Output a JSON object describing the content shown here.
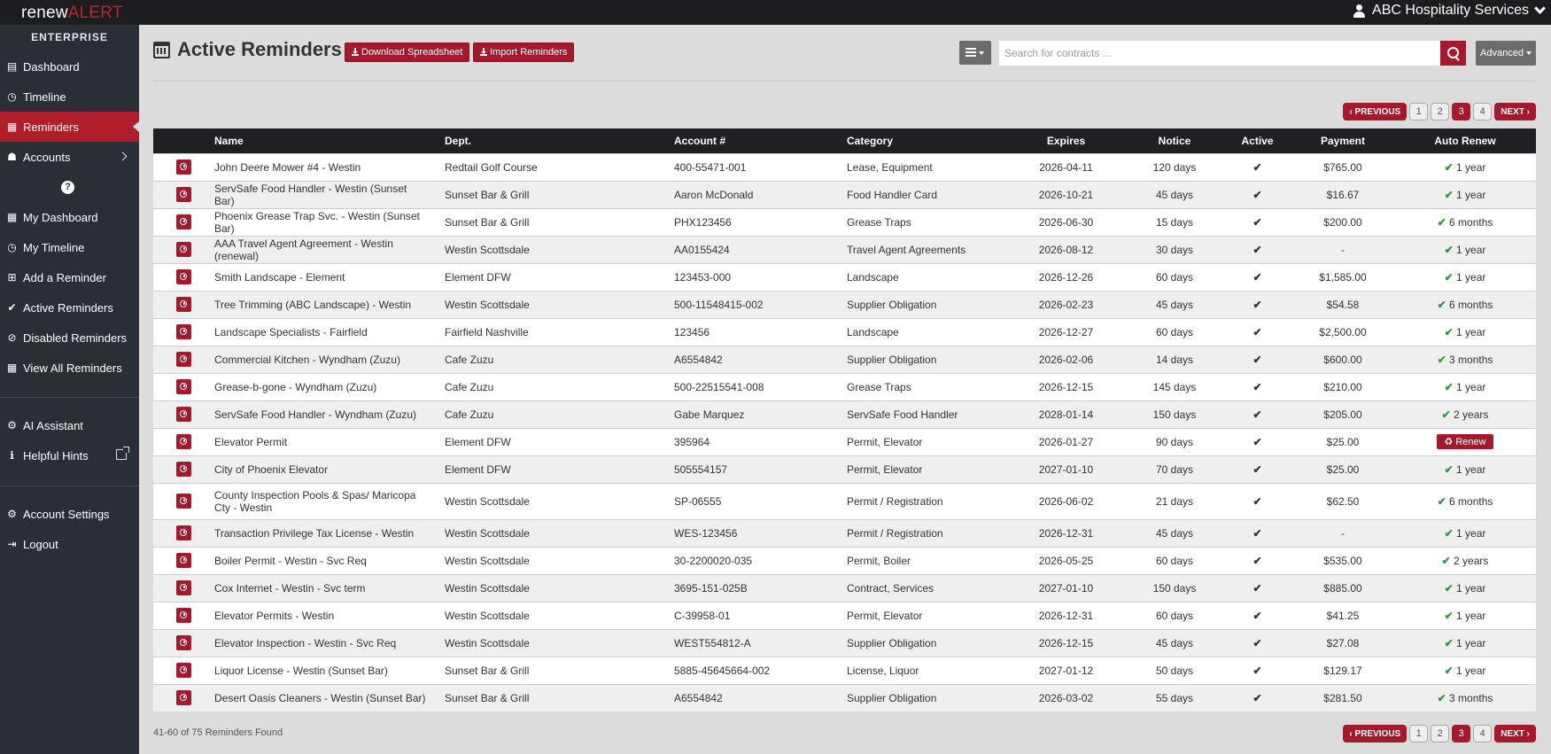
{
  "app": {
    "logo_text_1": "renew",
    "logo_text_2": "ALERT",
    "edition": "ENTERPRISE",
    "user": "ABC Hospitality Services"
  },
  "sidebar": {
    "primary": [
      {
        "label": "Dashboard",
        "icon": "dashboard-icon"
      },
      {
        "label": "Timeline",
        "icon": "clock-icon"
      },
      {
        "label": "Reminders",
        "icon": "calendar-icon",
        "active": true
      },
      {
        "label": "Accounts",
        "icon": "users-icon"
      }
    ],
    "help": "?",
    "secondary": [
      {
        "label": "My Dashboard",
        "icon": "grid-icon"
      },
      {
        "label": "My Timeline",
        "icon": "clock-icon"
      },
      {
        "label": "Add a Reminder",
        "icon": "calendar-plus-icon"
      },
      {
        "label": "Active Reminders",
        "icon": "check-icon"
      },
      {
        "label": "Disabled Reminders",
        "icon": "ban-icon"
      },
      {
        "label": "View All Reminders",
        "icon": "calendar-icon"
      }
    ],
    "tools": [
      {
        "label": "AI Assistant",
        "icon": "gears-icon"
      },
      {
        "label": "Helpful Hints",
        "icon": "info-icon"
      }
    ],
    "account": [
      {
        "label": "Account Settings",
        "icon": "gear-icon"
      },
      {
        "label": "Logout",
        "icon": "logout-icon"
      }
    ]
  },
  "header": {
    "title": "Active Reminders",
    "download_label": "Download Spreadsheet",
    "import_label": "Import Reminders",
    "search_placeholder": "Search for contracts ...",
    "advanced_label": "Advanced"
  },
  "pagination": {
    "prev": "‹ PREVIOUS",
    "next": "NEXT ›",
    "pages": [
      "1",
      "2",
      "3",
      "4"
    ],
    "current": "3"
  },
  "table": {
    "columns": [
      "Name",
      "Dept.",
      "Account #",
      "Category",
      "Expires",
      "Notice",
      "Active",
      "Payment",
      "Auto Renew"
    ],
    "rows": [
      {
        "name": "John Deere Mower #4 - Westin",
        "dept": "Redtail Golf Course",
        "account": "400-55471-001",
        "category": "Lease, Equipment",
        "expires": "2026-04-11",
        "notice": "120 days",
        "active": "✔",
        "payment": "$765.00",
        "renew": "✔ 1 year"
      },
      {
        "name": "ServSafe Food Handler - Westin (Sunset Bar)",
        "dept": "Sunset Bar & Grill",
        "account": "Aaron McDonald",
        "category": "Food Handler Card",
        "expires": "2026-10-21",
        "notice": "45 days",
        "active": "✔",
        "payment": "$16.67",
        "renew": "✔ 1 year"
      },
      {
        "name": "Phoenix Grease Trap Svc. - Westin (Sunset Bar)",
        "dept": "Sunset Bar & Grill",
        "account": "PHX123456",
        "category": "Grease Traps",
        "expires": "2026-06-30",
        "notice": "15 days",
        "active": "✔",
        "payment": "$200.00",
        "renew": "✔ 6 months"
      },
      {
        "name": "AAA Travel Agent Agreement - Westin (renewal)",
        "dept": "Westin Scottsdale",
        "account": "AA0155424",
        "category": "Travel Agent Agreements",
        "expires": "2026-08-12",
        "notice": "30 days",
        "active": "✔",
        "payment": "-",
        "renew": "✔ 1 year"
      },
      {
        "name": "Smith Landscape - Element",
        "dept": "Element DFW",
        "account": "123453-000",
        "category": "Landscape",
        "expires": "2026-12-26",
        "notice": "60 days",
        "active": "✔",
        "payment": "$1,585.00",
        "renew": "✔ 1 year"
      },
      {
        "name": "Tree Trimming (ABC Landscape) - Westin",
        "dept": "Westin Scottsdale",
        "account": "500-11548415-002",
        "category": "Supplier Obligation",
        "expires": "2026-02-23",
        "notice": "45 days",
        "active": "✔",
        "payment": "$54.58",
        "renew": "✔ 6 months"
      },
      {
        "name": "Landscape Specialists - Fairfield",
        "dept": "Fairfield Nashville",
        "account": "123456",
        "category": "Landscape",
        "expires": "2026-12-27",
        "notice": "60 days",
        "active": "✔",
        "payment": "$2,500.00",
        "renew": "✔ 1 year"
      },
      {
        "name": "Commercial Kitchen - Wyndham (Zuzu)",
        "dept": "Cafe Zuzu",
        "account": "A6554842",
        "category": "Supplier Obligation",
        "expires": "2026-02-06",
        "notice": "14 days",
        "active": "✔",
        "payment": "$600.00",
        "renew": "✔ 3 months"
      },
      {
        "name": "Grease-b-gone - Wyndham (Zuzu)",
        "dept": "Cafe Zuzu",
        "account": "500-22515541-008",
        "category": "Grease Traps",
        "expires": "2026-12-15",
        "notice": "145 days",
        "active": "✔",
        "payment": "$210.00",
        "renew": "✔ 1 year"
      },
      {
        "name": "ServSafe Food Handler - Wyndham (Zuzu)",
        "dept": "Cafe Zuzu",
        "account": "Gabe Marquez",
        "category": "ServSafe Food Handler",
        "expires": "2028-01-14",
        "notice": "150 days",
        "active": "✔",
        "payment": "$205.00",
        "renew": "✔ 2 years"
      },
      {
        "name": "Elevator Permit",
        "dept": "Element DFW",
        "account": "395964",
        "category": "Permit, Elevator",
        "expires": "2026-01-27",
        "notice": "90 days",
        "active": "✔",
        "payment": "$25.00",
        "renew": "♻ Renew",
        "renew_button": true
      },
      {
        "name": "City of Phoenix Elevator",
        "dept": "Element DFW",
        "account": "505554157",
        "category": "Permit, Elevator",
        "expires": "2027-01-10",
        "notice": "70 days",
        "active": "✔",
        "payment": "$25.00",
        "renew": "✔ 1 year"
      },
      {
        "name": "County Inspection Pools & Spas/ Maricopa Cty - Westin",
        "dept": "Westin Scottsdale",
        "account": "SP-06555",
        "category": "Permit / Registration",
        "expires": "2026-06-02",
        "notice": "21 days",
        "active": "✔",
        "payment": "$62.50",
        "renew": "✔ 6 months"
      },
      {
        "name": "Transaction Privilege Tax License - Westin",
        "dept": "Westin Scottsdale",
        "account": "WES-123456",
        "category": "Permit / Registration",
        "expires": "2026-12-31",
        "notice": "45 days",
        "active": "✔",
        "payment": "-",
        "renew": "✔ 1 year"
      },
      {
        "name": "Boiler Permit - Westin - Svc Req",
        "dept": "Westin Scottsdale",
        "account": "30-2200020-035",
        "category": "Permit, Boiler",
        "expires": "2026-05-25",
        "notice": "60 days",
        "active": "✔",
        "payment": "$535.00",
        "renew": "✔ 2 years"
      },
      {
        "name": "Cox Internet - Westin - Svc term",
        "dept": "Westin Scottsdale",
        "account": "3695-151-025B",
        "category": "Contract, Services",
        "expires": "2027-01-10",
        "notice": "150 days",
        "active": "✔",
        "payment": "$885.00",
        "renew": "✔ 1 year"
      },
      {
        "name": "Elevator Permits - Westin",
        "dept": "Westin Scottsdale",
        "account": "C-39958-01",
        "category": "Permit, Elevator",
        "expires": "2026-12-31",
        "notice": "60 days",
        "active": "✔",
        "payment": "$41.25",
        "renew": "✔ 1 year"
      },
      {
        "name": "Elevator Inspection - Westin - Svc Req",
        "dept": "Westin Scottsdale",
        "account": "WEST554812-A",
        "category": "Supplier Obligation",
        "expires": "2026-12-15",
        "notice": "45 days",
        "active": "✔",
        "payment": "$27.08",
        "renew": "✔ 1 year"
      },
      {
        "name": "Liquor License - Westin (Sunset Bar)",
        "dept": "Sunset Bar & Grill",
        "account": "5885-45645664-002",
        "category": "License, Liquor",
        "expires": "2027-01-12",
        "notice": "50 days",
        "active": "✔",
        "payment": "$129.17",
        "renew": "✔ 1 year"
      },
      {
        "name": "Desert Oasis Cleaners - Westin (Sunset Bar)",
        "dept": "Sunset Bar & Grill",
        "account": "A6554842",
        "category": "Supplier Obligation",
        "expires": "2026-03-02",
        "notice": "55 days",
        "active": "✔",
        "payment": "$281.50",
        "renew": "✔ 3 months"
      }
    ]
  },
  "footer": {
    "count": "41-60 of 75 Reminders Found"
  },
  "colors": {
    "accent": "#a5192a",
    "sidebar": "#2b2e35",
    "check": "#2a9c3a"
  }
}
